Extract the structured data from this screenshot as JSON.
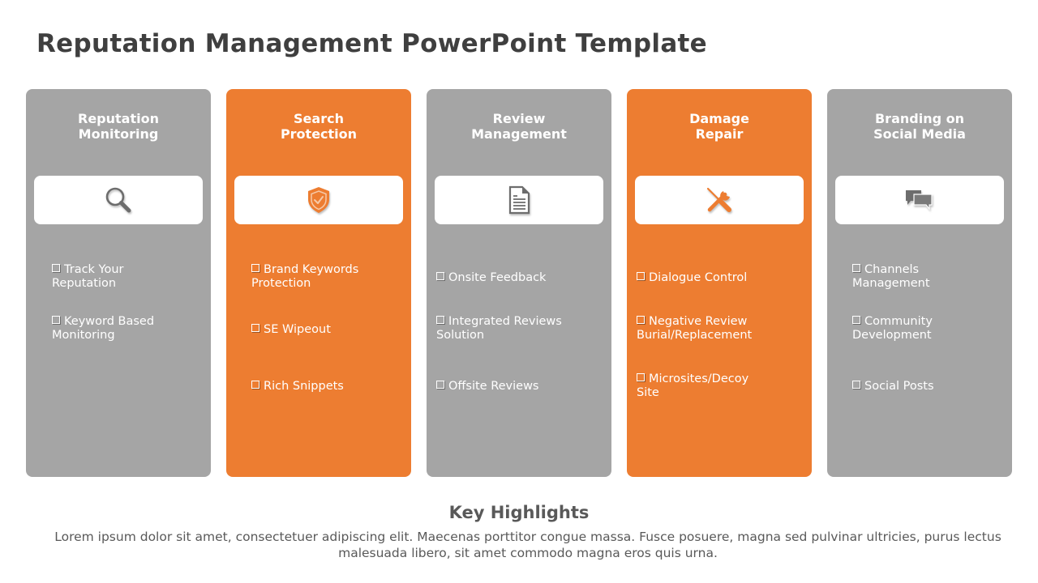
{
  "title": "Reputation Management PowerPoint Template",
  "colors": {
    "gray": "#a5a5a5",
    "orange": "#ed7d31",
    "icon_gray": "#6d6d6d",
    "text_dark": "#3f3f3f"
  },
  "cards": [
    {
      "heading": "Reputation\nMonitoring",
      "theme": "gray",
      "icon": "magnifier-icon",
      "items": [
        "Track Your\n Reputation",
        "Keyword Based\nMonitoring"
      ]
    },
    {
      "heading": "Search\nProtection",
      "theme": "orange",
      "icon": "shield-check-icon",
      "items": [
        "Brand Keywords\nProtection",
        "SE Wipeout",
        "Rich Snippets"
      ]
    },
    {
      "heading": "Review\nManagement",
      "theme": "gray",
      "icon": "document-icon",
      "items": [
        "Onsite Feedback",
        "Integrated Reviews\nSolution",
        "Offsite Reviews"
      ]
    },
    {
      "heading": "Damage\nRepair",
      "theme": "orange",
      "icon": "tools-icon",
      "items": [
        "Dialogue Control",
        "Negative Review\nBurial/Replacement",
        "Microsites/Decoy\nSite"
      ]
    },
    {
      "heading": "Branding on\nSocial Media",
      "theme": "gray",
      "icon": "chat-bubbles-icon",
      "items": [
        "Channels\nManagement",
        "Community\nDevelopment",
        "Social Posts"
      ]
    }
  ],
  "highlights": {
    "title": "Key Highlights",
    "body": "Lorem ipsum dolor sit amet, consectetuer adipiscing elit. Maecenas porttitor congue massa. Fusce posuere, magna sed pulvinar ultricies, purus lectus malesuada libero, sit amet commodo magna eros quis urna."
  }
}
